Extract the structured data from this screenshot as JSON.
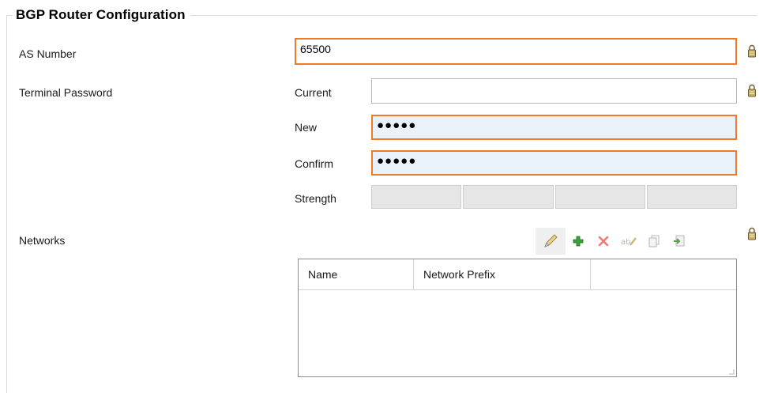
{
  "section": {
    "title": "BGP Router Configuration"
  },
  "as_number": {
    "label": "AS Number",
    "value": "65500"
  },
  "terminal_password": {
    "label": "Terminal Password",
    "current": {
      "label": "Current",
      "value": ""
    },
    "new": {
      "label": "New",
      "value": "●●●●●"
    },
    "confirm": {
      "label": "Confirm",
      "value": "●●●●●"
    },
    "strength": {
      "label": "Strength",
      "segments": 4,
      "filled": 0
    }
  },
  "networks": {
    "label": "Networks",
    "toolbar": [
      "pencil-icon",
      "add-icon",
      "delete-icon",
      "rename-icon",
      "copy-icon",
      "import-icon"
    ],
    "columns": [
      "Name",
      "Network Prefix",
      ""
    ],
    "rows": []
  },
  "colors": {
    "invalid_border": "#ee7b27",
    "filled_bg": "#e9f1fb",
    "lock": "#7a6a3a"
  }
}
